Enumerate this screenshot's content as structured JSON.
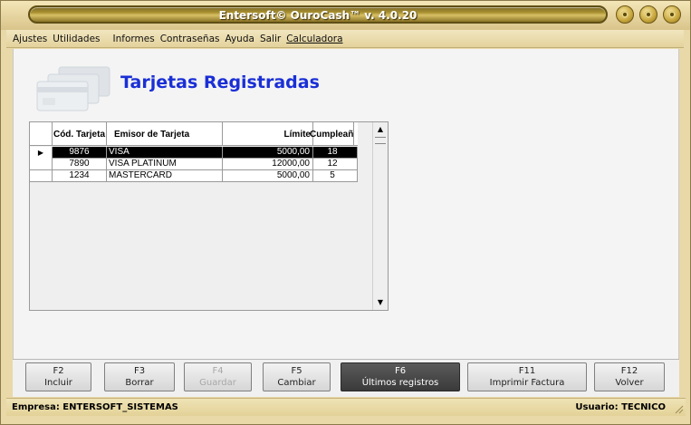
{
  "window": {
    "title": "Entersoft© OuroCash™ v. 4.0.20"
  },
  "menu": [
    {
      "label": "Ajustes"
    },
    {
      "label": "Utilidades"
    },
    {
      "label": "Informes"
    },
    {
      "label": "Contraseñas"
    },
    {
      "label": "Ayuda"
    },
    {
      "label": "Salir"
    },
    {
      "label": "Calculadora"
    }
  ],
  "page": {
    "title": "Tarjetas Registradas"
  },
  "grid": {
    "columns": [
      "Cód. Tarjeta",
      "Emisor de Tarjeta",
      "Límite",
      "Cumpleaño"
    ],
    "rows": [
      {
        "codigo": "9876",
        "emisor": "VISA",
        "limite": "5000,00",
        "cumpleano": "18",
        "selected": true
      },
      {
        "codigo": "7890",
        "emisor": "VISA PLATINUM",
        "limite": "12000,00",
        "cumpleano": "12",
        "selected": false
      },
      {
        "codigo": "1234",
        "emisor": "MASTERCARD",
        "limite": "5000,00",
        "cumpleano": "5",
        "selected": false
      }
    ],
    "row_indicator": "▶",
    "scroll_up": "▲",
    "scroll_down": "▼"
  },
  "fkeys": [
    {
      "key": "F2",
      "label": "Incluir",
      "state": "normal"
    },
    {
      "key": "F3",
      "label": "Borrar",
      "state": "normal"
    },
    {
      "key": "F4",
      "label": "Guardar",
      "state": "disabled"
    },
    {
      "key": "F5",
      "label": "Cambiar",
      "state": "normal"
    },
    {
      "key": "F6",
      "label": "Últimos registros",
      "state": "active"
    },
    {
      "key": "F11",
      "label": "Imprimir Factura",
      "state": "normal"
    },
    {
      "key": "F12",
      "label": "Volver",
      "state": "normal"
    }
  ],
  "status": {
    "empresa": "Empresa: ENTERSOFT_SISTEMAS",
    "usuario": "Usuario: TECNICO"
  },
  "icons": {
    "titlebar_buttons": [
      "minimize-icon",
      "maximize-icon",
      "close-icon"
    ],
    "header_graphic": "credit-cards-icon"
  },
  "colors": {
    "title_color": "#1a2fd6",
    "frame": "#e9d9a8",
    "selected_row": "#000000"
  }
}
